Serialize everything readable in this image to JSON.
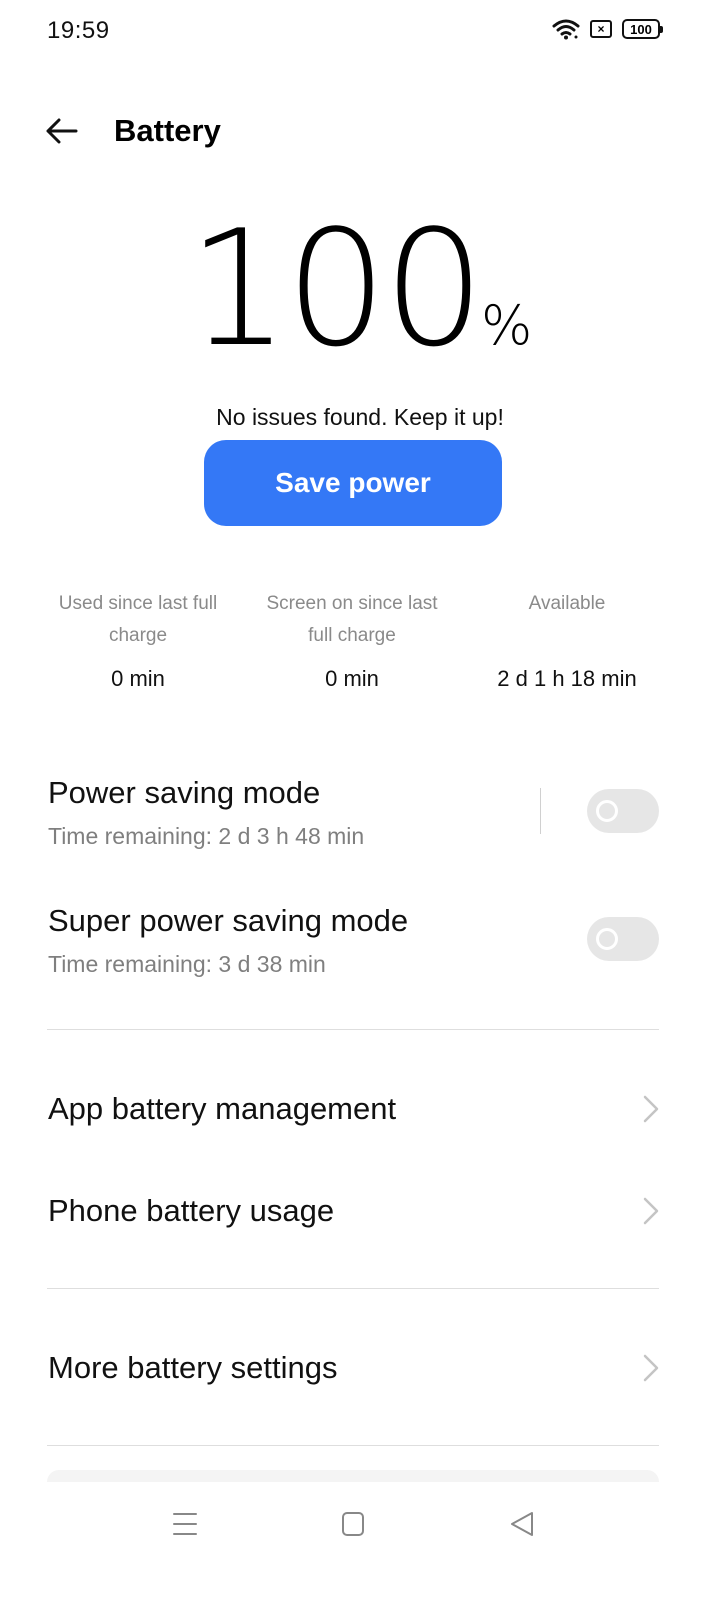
{
  "status_bar": {
    "time": "19:59",
    "sim_label": "×",
    "battery_label": "100"
  },
  "header": {
    "title": "Battery",
    "back_icon": "arrow-left-icon"
  },
  "battery": {
    "percent": "100",
    "percent_sign": "%",
    "message": "No issues found. Keep it up!",
    "save_button": "Save power"
  },
  "stats": [
    {
      "label": "Used since last full charge",
      "value": "0 min"
    },
    {
      "label": "Screen on since last full charge",
      "value": "0 min"
    },
    {
      "label": "Available",
      "value": "2 d 1 h 18 min"
    }
  ],
  "modes": [
    {
      "title": "Power saving mode",
      "subtitle": "Time remaining:  2 d 3 h 48 min",
      "enabled": false
    },
    {
      "title": "Super power saving mode",
      "subtitle": "Time remaining:  3 d 38 min",
      "enabled": false
    }
  ],
  "menu": [
    {
      "label": "App battery management"
    },
    {
      "label": "Phone battery usage"
    },
    {
      "label": "More battery settings"
    }
  ],
  "colors": {
    "accent": "#3478f6",
    "toggle_off": "#e6e6e6"
  },
  "nav_icons": [
    "menu-icon",
    "home-icon",
    "back-triangle-icon"
  ]
}
